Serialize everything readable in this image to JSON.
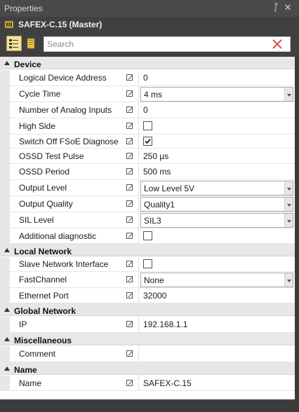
{
  "panel": {
    "title": "Properties",
    "object_name": "SAFEX-C.15 (Master)"
  },
  "search": {
    "placeholder": "Search"
  },
  "categories": [
    {
      "label": "Device",
      "rows": [
        {
          "label": "Logical Device Address",
          "type": "text",
          "value": "0"
        },
        {
          "label": "Cycle Time",
          "type": "combo",
          "value": "4 ms"
        },
        {
          "label": "Number of Analog Inputs",
          "type": "text",
          "value": "0"
        },
        {
          "label": "High Side",
          "type": "check",
          "checked": false
        },
        {
          "label": "Switch Off FSoE Diagnose",
          "type": "check",
          "checked": true
        },
        {
          "label": "OSSD Test Pulse",
          "type": "text",
          "value": "250 µs"
        },
        {
          "label": "OSSD Period",
          "type": "text",
          "value": "500 ms"
        },
        {
          "label": "Output Level",
          "type": "combo",
          "value": "Low Level 5V"
        },
        {
          "label": "Output Quality",
          "type": "combo",
          "value": "Quality1"
        },
        {
          "label": "SIL Level",
          "type": "combo",
          "value": "SIL3"
        },
        {
          "label": "Additional diagnostic",
          "type": "check",
          "checked": false
        }
      ]
    },
    {
      "label": "Local Network",
      "rows": [
        {
          "label": "Slave Network Interface",
          "type": "check",
          "checked": false
        },
        {
          "label": "FastChannel",
          "type": "combo",
          "value": "None"
        },
        {
          "label": "Ethernet Port",
          "type": "text",
          "value": "32000"
        }
      ]
    },
    {
      "label": "Global Network",
      "rows": [
        {
          "label": "IP",
          "type": "text",
          "value": "192.168.1.1"
        }
      ]
    },
    {
      "label": "Miscellaneous",
      "rows": [
        {
          "label": "Comment",
          "type": "text",
          "value": ""
        }
      ]
    },
    {
      "label": "Name",
      "rows": [
        {
          "label": "Name",
          "type": "text",
          "value": "SAFEX-C.15"
        }
      ]
    }
  ]
}
